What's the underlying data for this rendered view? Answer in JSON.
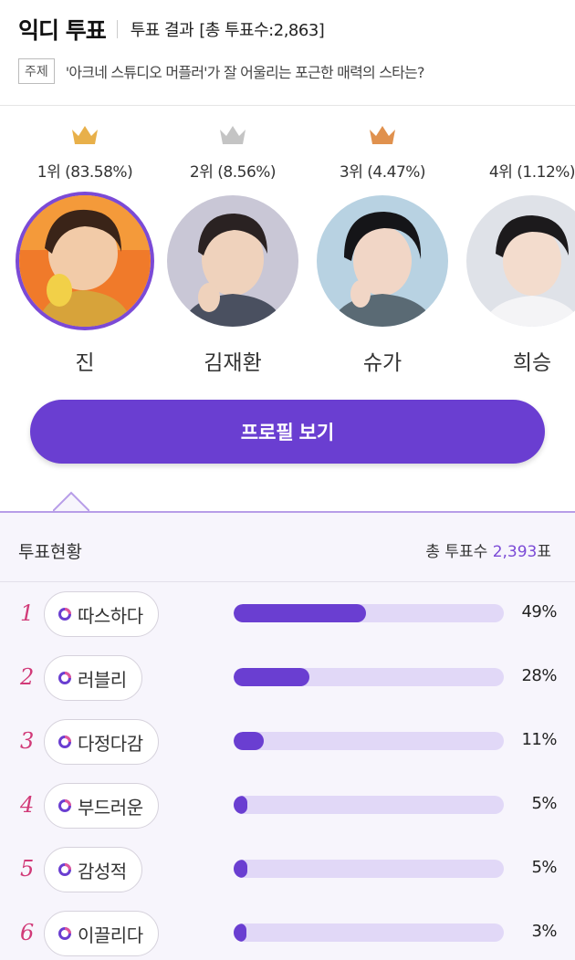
{
  "header": {
    "app_title": "익디 투표",
    "result_label": "투표 결과",
    "result_total": "[총 투표수:2,863]",
    "topic_badge": "주제",
    "topic_text": "'아크네 스튜디오 머플러'가 잘 어울리는 포근한 매력의 스타는?"
  },
  "candidates": [
    {
      "rank_text": "1위 (83.58%)",
      "name": "진",
      "crown": "gold-crown-icon",
      "crown_color": "#e8b04a",
      "selected": true
    },
    {
      "rank_text": "2위 (8.56%)",
      "name": "김재환",
      "crown": "silver-crown-icon",
      "crown_color": "#c4c4c4",
      "selected": false
    },
    {
      "rank_text": "3위 (4.47%)",
      "name": "슈가",
      "crown": "bronze-crown-icon",
      "crown_color": "#e0914e",
      "selected": false
    },
    {
      "rank_text": "4위 (1.12%)",
      "name": "희승",
      "crown": "",
      "selected": false
    }
  ],
  "profile_button": "프로필 보기",
  "status": {
    "title": "투표현황",
    "total_label": "총 투표수",
    "total_value": "2,393",
    "total_unit": "표",
    "items": [
      {
        "rank": "1",
        "label": "따스하다",
        "percent": 49,
        "percent_text": "49%"
      },
      {
        "rank": "2",
        "label": "러블리",
        "percent": 28,
        "percent_text": "28%"
      },
      {
        "rank": "3",
        "label": "다정다감",
        "percent": 11,
        "percent_text": "11%"
      },
      {
        "rank": "4",
        "label": "부드러운",
        "percent": 5,
        "percent_text": "5%"
      },
      {
        "rank": "5",
        "label": "감성적",
        "percent": 5,
        "percent_text": "5%"
      },
      {
        "rank": "6",
        "label": "이끌리다",
        "percent": 3,
        "percent_text": "3%"
      }
    ]
  },
  "colors": {
    "accent": "#6a3ed1",
    "bar_track": "#e1d8f7",
    "rank_pink": "#d13a78"
  }
}
